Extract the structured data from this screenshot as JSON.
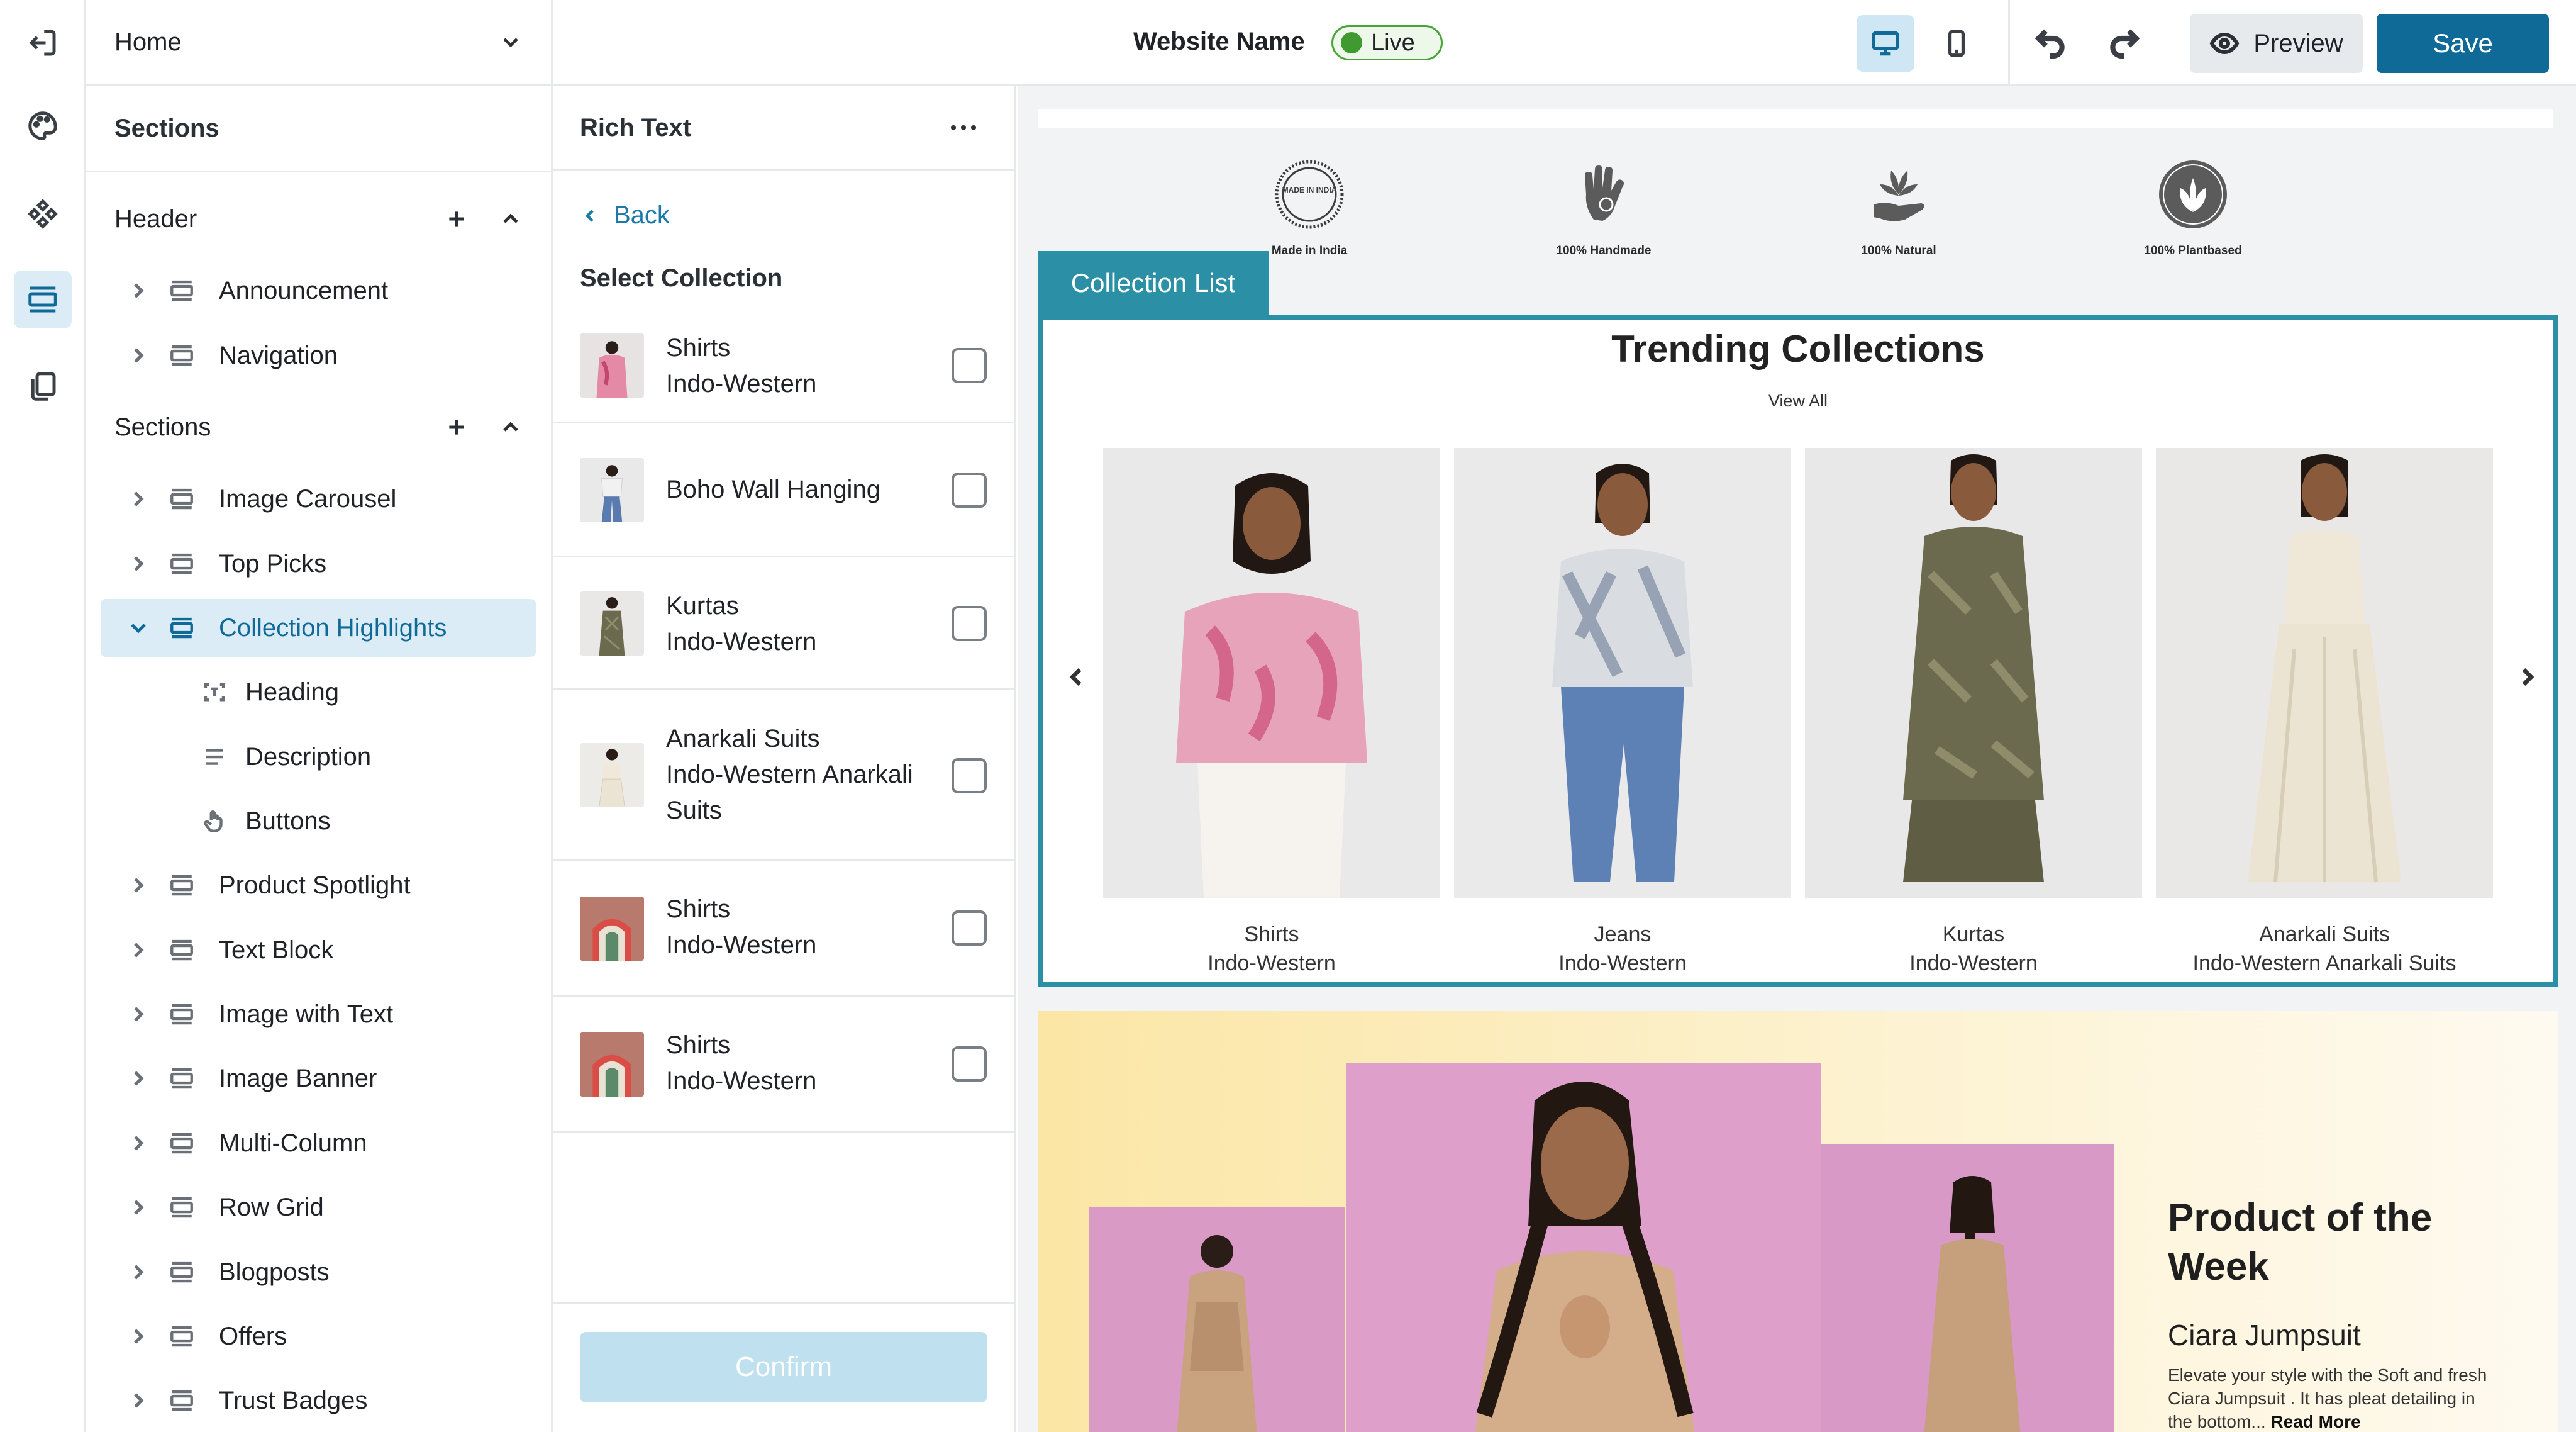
{
  "topbar": {
    "site_name": "Website Name",
    "live_label": "Live",
    "preview_label": "Preview",
    "save_label": "Save"
  },
  "rail": {
    "icons": [
      "exit-icon",
      "palette-icon",
      "components-icon",
      "sections-icon",
      "pages-icon"
    ],
    "active": "sections-icon"
  },
  "sidebar": {
    "page_select": "Home",
    "title": "Sections",
    "header_group": {
      "label": "Header",
      "items": [
        "Announcement",
        "Navigation"
      ]
    },
    "sections_group": {
      "label": "Sections",
      "items": [
        "Image Carousel",
        "Top Picks",
        "Collection Highlights",
        "Product Spotlight",
        "Text Block",
        "Image with Text",
        "Image Banner",
        "Multi-Column",
        "Row Grid",
        "Blogposts",
        "Offers",
        "Trust Badges"
      ],
      "selected": "Collection Highlights",
      "children": [
        "Heading",
        "Description",
        "Buttons"
      ]
    }
  },
  "panel": {
    "title": "Rich Text",
    "back_label": "Back",
    "select_label": "Select Collection",
    "collections": [
      {
        "name": "Shirts",
        "sub": "Indo-Western",
        "checked": false
      },
      {
        "name": "Boho Wall Hanging",
        "sub": "",
        "checked": false
      },
      {
        "name": "Kurtas",
        "sub": "Indo-Western",
        "checked": false
      },
      {
        "name": "Anarkali Suits",
        "sub": "Indo-Western Anarkali Suits",
        "checked": false
      },
      {
        "name": "Shirts",
        "sub": "Indo-Western",
        "checked": false
      },
      {
        "name": "Shirts",
        "sub": "Indo-Western",
        "checked": false
      }
    ],
    "confirm_label": "Confirm"
  },
  "preview": {
    "badges": [
      "Made in India",
      "100% Handmade",
      "100% Natural",
      "100% Plantbased"
    ],
    "badge_stamp_text": "MADE IN INDIA",
    "collection_tag": "Collection List",
    "trending": {
      "title": "Trending Collections",
      "view_all": "View All",
      "cards": [
        {
          "name": "Shirts",
          "sub": "Indo-Western"
        },
        {
          "name": "Jeans",
          "sub": "Indo-Western"
        },
        {
          "name": "Kurtas",
          "sub": "Indo-Western"
        },
        {
          "name": "Anarkali Suits",
          "sub": "Indo-Western Anarkali Suits"
        }
      ]
    },
    "product_of_week": {
      "title": "Product of the Week",
      "product_name": "Ciara Jumpsuit",
      "description": "Elevate your style with the Soft and fresh Ciara Jumpsuit . It has pleat detailing in the bottom...",
      "read_more": "Read More"
    }
  },
  "colors": {
    "accent": "#0f6a98",
    "selection_bg": "#dcecf6",
    "collection_frame": "#2b8fa6",
    "live_green": "#3f9a2f",
    "confirm_disabled": "#bfe0ee"
  }
}
